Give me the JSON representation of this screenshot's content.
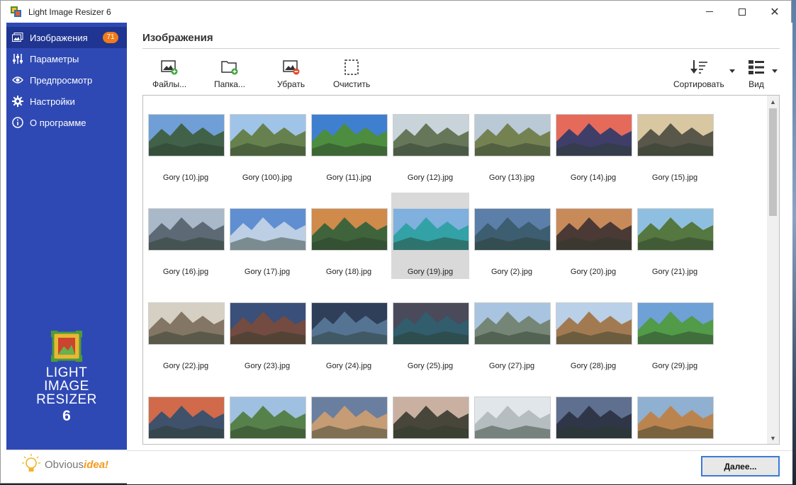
{
  "window": {
    "title": "Light Image Resizer 6",
    "controls": {
      "minimize": "minimize",
      "maximize": "maximize",
      "close": "✕"
    }
  },
  "sidebar": {
    "items": [
      {
        "label": "Изображения",
        "icon": "images-icon",
        "badge": "71",
        "active": true
      },
      {
        "label": "Параметры",
        "icon": "sliders-icon"
      },
      {
        "label": "Предпросмотр",
        "icon": "eye-icon"
      },
      {
        "label": "Настройки",
        "icon": "gear-icon"
      },
      {
        "label": "О программе",
        "icon": "info-icon"
      }
    ],
    "logo": {
      "line1": "LIGHT",
      "line2": "IMAGE",
      "line3": "RESIZER",
      "line4": "6"
    },
    "brand": {
      "part1": "Obvious",
      "part2": "idea!"
    }
  },
  "main": {
    "title": "Изображения",
    "toolbar": {
      "files": "Файлы...",
      "folder": "Папка...",
      "remove": "Убрать",
      "clear": "Очистить",
      "sort": "Сортировать",
      "view": "Вид"
    },
    "files": [
      "Gory (10).jpg",
      "Gory (100).jpg",
      "Gory (11).jpg",
      "Gory (12).jpg",
      "Gory (13).jpg",
      "Gory (14).jpg",
      "Gory (15).jpg",
      "Gory (16).jpg",
      "Gory (17).jpg",
      "Gory (18).jpg",
      "Gory (19).jpg",
      "Gory (2).jpg",
      "Gory (20).jpg",
      "Gory (21).jpg",
      "Gory (22).jpg",
      "Gory (23).jpg",
      "Gory (24).jpg",
      "Gory (25).jpg",
      "Gory (27).jpg",
      "Gory (28).jpg",
      "Gory (29).jpg",
      "",
      "",
      "",
      "",
      "",
      "",
      ""
    ],
    "selected_index": 10,
    "next_button": "Далее..."
  },
  "colors": {
    "sidebar": "#2f49b4",
    "sidebar_active": "#1f3591",
    "badge": "#f07b1a",
    "accent_border": "#3a7bd5"
  }
}
